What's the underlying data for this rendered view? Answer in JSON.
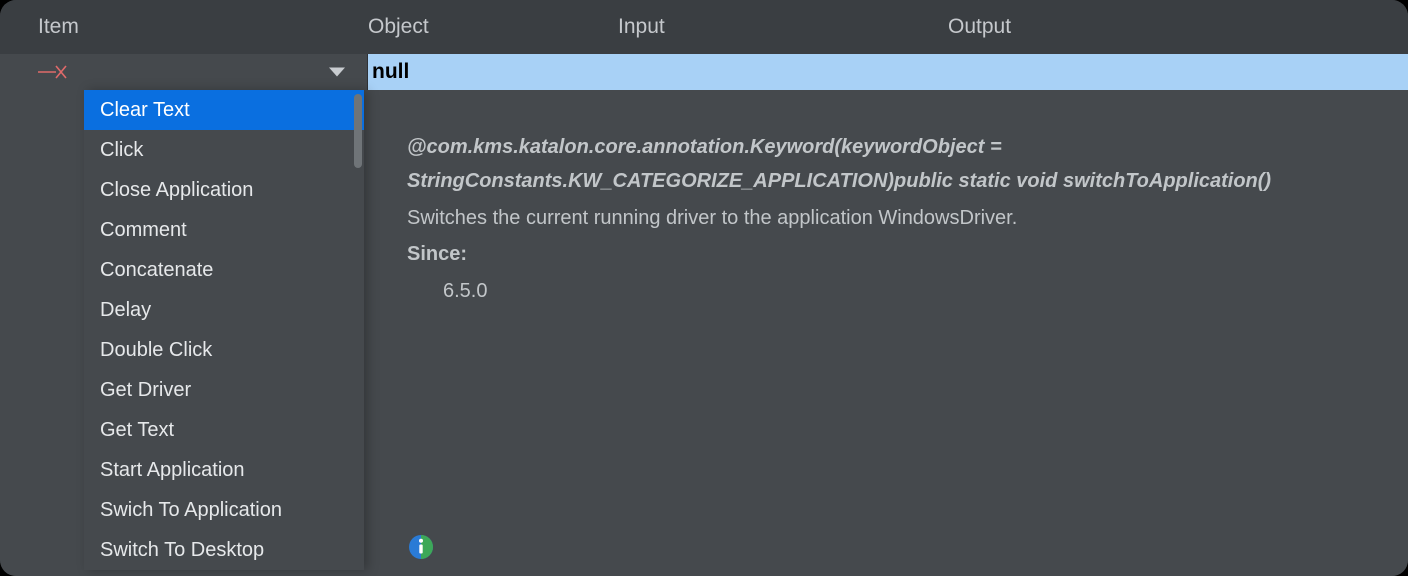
{
  "headers": {
    "item": "Item",
    "object": "Object",
    "input": "Input",
    "output": "Output"
  },
  "selected_value": "null",
  "dropdown": {
    "items": [
      "Clear Text",
      "Click",
      "Close Application",
      "Comment",
      "Concatenate",
      "Delay",
      "Double Click",
      "Get Driver",
      "Get Text",
      "Start Application",
      "Swich To Application",
      "Switch To Desktop"
    ],
    "highlighted_index": 0
  },
  "detail": {
    "annotation": "@com.kms.katalon.core.annotation.Keyword(keywordObject = StringConstants.KW_CATEGORIZE_APPLICATION)public static void switchToApplication()",
    "description": "Switches the current running driver to the application WindowsDriver.",
    "since_label": "Since:",
    "since_value": "6.5.0"
  },
  "icons": {
    "red_x": "red-x-icon",
    "caret": "chevron-down-icon",
    "info": "info-icon"
  }
}
